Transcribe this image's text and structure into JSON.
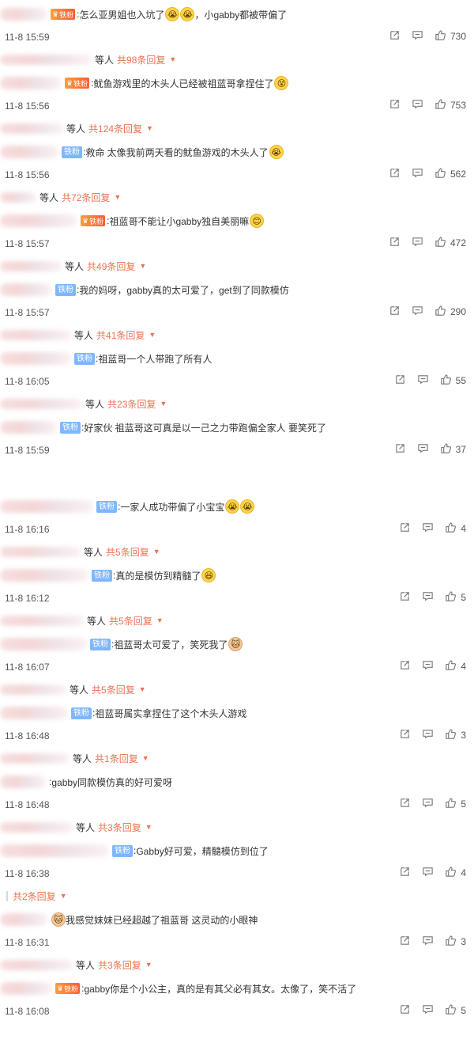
{
  "comments": [
    {
      "text": "怎么亚男姐也入坑了",
      "badge": "vip",
      "emojis": [
        "😭",
        "😭"
      ],
      "tail": "，小gabby都被带偏了",
      "time": "11-8 15:59",
      "likes": "730",
      "reply_count": "共98条回复"
    },
    {
      "text": "鱿鱼游戏里的木头人已经被祖蓝哥拿捏住了",
      "badge": "vip",
      "emojis": [
        "😵"
      ],
      "tail": "",
      "time": "11-8 15:56",
      "likes": "753",
      "reply_count": "共124条回复"
    },
    {
      "text": "救命 太像我前两天看的鱿鱼游戏的木头人了",
      "badge": "fan",
      "emojis": [
        "😭"
      ],
      "tail": "",
      "time": "11-8 15:56",
      "likes": "562",
      "reply_count": "共72条回复"
    },
    {
      "text": "祖蓝哥不能让小gabby独自美丽嘛",
      "badge": "vip",
      "emojis": [
        "😊"
      ],
      "tail": "",
      "time": "11-8 15:57",
      "likes": "472",
      "reply_count": "共49条回复"
    },
    {
      "text": "我的妈呀，gabby真的太可爱了，get到了同款模仿",
      "badge": "fan",
      "emojis": [],
      "tail": "",
      "time": "11-8 15:57",
      "likes": "290",
      "reply_count": "共41条回复"
    },
    {
      "text": "祖蓝哥一个人带跑了所有人",
      "badge": "fan",
      "emojis": [],
      "tail": "",
      "time": "11-8 16:05",
      "likes": "55",
      "reply_count": "共23条回复"
    },
    {
      "text": "好家伙 祖蓝哥这可真是以一己之力带跑偏全家人 要笑死了",
      "badge": "fan",
      "emojis": [],
      "tail": "",
      "time": "11-8 15:59",
      "likes": "37",
      "reply_count": ""
    },
    {
      "text": "一家人成功带偏了小宝宝",
      "badge": "fan",
      "emojis": [
        "😭",
        "😭"
      ],
      "tail": "",
      "time": "11-8 16:16",
      "likes": "4",
      "reply_count": "共5条回复"
    },
    {
      "text": "真的是模仿到精髓了",
      "badge": "fan",
      "emojis": [
        "😆"
      ],
      "tail": "",
      "time": "11-8 16:12",
      "likes": "5",
      "reply_count": "共5条回复"
    },
    {
      "text": "祖蓝哥太可爱了，笑死我了",
      "badge": "fan",
      "emojis": [
        "🐱"
      ],
      "tail": "",
      "time": "11-8 16:07",
      "likes": "4",
      "reply_count": "共5条回复"
    },
    {
      "text": "祖蓝哥属实拿捏住了这个木头人游戏",
      "badge": "fan",
      "emojis": [],
      "tail": "",
      "time": "11-8 16:48",
      "likes": "3",
      "reply_count": "共1条回复"
    },
    {
      "text": "gabby同款模仿真的好可爱呀",
      "badge": "none",
      "emojis": [],
      "tail": "",
      "time": "11-8 16:48",
      "likes": "5",
      "reply_count": "共3条回复"
    },
    {
      "text": "Gabby好可爱，精髓模仿到位了",
      "badge": "fan",
      "emojis": [],
      "tail": "",
      "time": "11-8 16:38",
      "likes": "4",
      "reply_count": "共2条回复"
    },
    {
      "text": "我感觉妹妹已经超越了祖蓝哥 这灵动的小眼神",
      "badge": "none",
      "emojis": [],
      "lead_emoji": "🐱",
      "tail": "",
      "time": "11-8 16:31",
      "likes": "3",
      "reply_count": "共3条回复"
    },
    {
      "text": "gabby你是个小公主，真的是有其父必有其女。太像了，笑不活了",
      "badge": "vip",
      "emojis": [],
      "tail": "",
      "time": "11-8 16:08",
      "likes": "5",
      "reply_count": ""
    }
  ],
  "labels": {
    "reply_prefix": "等人",
    "fan_badge": "铁粉",
    "vip_badge": "铁粉",
    "colon": ":"
  },
  "icons": {
    "share": "share-icon",
    "comment": "comment-icon",
    "like": "like-icon"
  },
  "colors": {
    "accent": "#eb7350",
    "fan_badge": "#7fb7ff",
    "vip_badge": "#ff7a2e"
  }
}
